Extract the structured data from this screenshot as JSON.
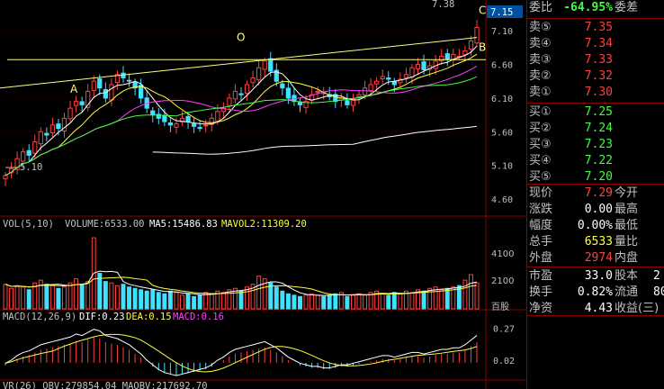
{
  "indicators": {
    "vol_text": "VOL(5,10)",
    "volume_text": "VOLUME:6533.00",
    "ma5_text": "MA5:15486.83",
    "mavol2_text": "MAVOL2:11309.20",
    "macd_params": "MACD(12,26,9)",
    "dif_text": "DIF:0.23",
    "dea_text": "DEA:0.15",
    "macd_text": "MACD:0.16",
    "bottom_text": "VR(26) OBV:279854.04 MAOBV:217692.70"
  },
  "chart_data": {
    "type": "candlestick",
    "title": "",
    "xlabel": "",
    "ylabel": "",
    "price_ylim": [
      4.4,
      7.45
    ],
    "price_ticks": [
      "7.10",
      "6.60",
      "6.10",
      "5.60",
      "5.10",
      "4.60"
    ],
    "volume_ticks": [
      "4100",
      "2100",
      "百股"
    ],
    "macd_ticks": [
      "0.27",
      "0.02"
    ],
    "last_price_label": "7.15",
    "high_label": "7.38",
    "low_label": "5.10",
    "annotations": [
      "A",
      "O",
      "B",
      "C"
    ],
    "colors": {
      "up": "#ff4040",
      "down": "#40e0ff",
      "ma5": "#ffffff",
      "ma10": "#ffff40",
      "ma20": "#ff40ff",
      "ma30": "#40ff40",
      "ma60": "#ffffff",
      "trendline": "#ffff80",
      "axis": "#8b0000"
    },
    "series_ohlc_note": "daily candles",
    "closes": [
      4.95,
      5.05,
      5.2,
      5.3,
      5.25,
      5.45,
      5.6,
      5.55,
      5.7,
      5.65,
      5.8,
      5.95,
      6.05,
      6.0,
      6.2,
      6.35,
      6.25,
      6.1,
      6.3,
      6.45,
      6.4,
      6.35,
      6.25,
      6.1,
      5.95,
      5.85,
      5.8,
      5.75,
      5.7,
      5.72,
      5.8,
      5.75,
      5.68,
      5.65,
      5.7,
      5.8,
      5.9,
      5.95,
      6.1,
      6.2,
      6.15,
      6.3,
      6.4,
      6.55,
      6.65,
      6.5,
      6.35,
      6.25,
      6.1,
      6.05,
      6.0,
      6.05,
      6.15,
      6.2,
      6.18,
      6.12,
      6.05,
      6.1,
      6.0,
      6.08,
      6.15,
      6.25,
      6.3,
      6.35,
      6.42,
      6.38,
      6.3,
      6.38,
      6.45,
      6.55,
      6.6,
      6.52,
      6.58,
      6.65,
      6.72,
      6.68,
      6.75,
      6.72,
      6.8,
      6.95,
      7.15
    ],
    "volume": [
      1800,
      1500,
      1700,
      1600,
      1400,
      1900,
      2100,
      1800,
      1700,
      1500,
      1600,
      1900,
      2200,
      1800,
      2000,
      5200,
      2600,
      2000,
      1900,
      1700,
      1800,
      1600,
      1500,
      1400,
      1300,
      1400,
      1200,
      1100,
      1300,
      1200,
      1000,
      1100,
      900,
      1000,
      1200,
      1100,
      1300,
      1200,
      1400,
      1500,
      1300,
      1600,
      1800,
      2400,
      2200,
      1900,
      1600,
      1300,
      1100,
      1000,
      900,
      1000,
      1100,
      1000,
      900,
      1000,
      1100,
      1200,
      900,
      1000,
      1100,
      1000,
      1200,
      1300,
      1100,
      1000,
      1200,
      1100,
      1300,
      1200,
      1400,
      1300,
      1500,
      1600,
      1400,
      1500,
      1600,
      1700,
      2100,
      2500,
      1900
    ],
    "macd": [
      -0.02,
      0.0,
      0.03,
      0.05,
      0.06,
      0.08,
      0.1,
      0.11,
      0.12,
      0.13,
      0.14,
      0.15,
      0.17,
      0.16,
      0.18,
      0.2,
      0.19,
      0.16,
      0.15,
      0.14,
      0.12,
      0.1,
      0.07,
      0.04,
      0.0,
      -0.03,
      -0.06,
      -0.08,
      -0.09,
      -0.1,
      -0.09,
      -0.08,
      -0.07,
      -0.06,
      -0.05,
      -0.03,
      0.0,
      0.02,
      0.05,
      0.07,
      0.08,
      0.09,
      0.1,
      0.11,
      0.12,
      0.1,
      0.08,
      0.05,
      0.02,
      0.0,
      -0.02,
      -0.03,
      -0.04,
      -0.04,
      -0.05,
      -0.05,
      -0.04,
      -0.03,
      -0.03,
      -0.02,
      -0.01,
      0.0,
      0.01,
      0.02,
      0.03,
      0.03,
      0.02,
      0.03,
      0.04,
      0.05,
      0.05,
      0.04,
      0.05,
      0.06,
      0.07,
      0.07,
      0.08,
      0.08,
      0.1,
      0.13,
      0.16
    ]
  },
  "quote": {
    "weibi_label": "委比",
    "weibi_value": "-64.95%",
    "weicha_label": "委差",
    "sell": [
      {
        "label": "卖⑤",
        "price": "7.35"
      },
      {
        "label": "卖④",
        "price": "7.34"
      },
      {
        "label": "卖③",
        "price": "7.33"
      },
      {
        "label": "卖②",
        "price": "7.32"
      },
      {
        "label": "卖①",
        "price": "7.30"
      }
    ],
    "buy": [
      {
        "label": "买①",
        "price": "7.25"
      },
      {
        "label": "买②",
        "price": "7.24"
      },
      {
        "label": "买③",
        "price": "7.23"
      },
      {
        "label": "买④",
        "price": "7.22"
      },
      {
        "label": "买⑤",
        "price": "7.20"
      }
    ],
    "stats": [
      {
        "label": "现价",
        "value": "7.29",
        "label2": "今开",
        "color": "#ff4040"
      },
      {
        "label": "涨跌",
        "value": "0.00",
        "label2": "最高",
        "color": "#ffffff"
      },
      {
        "label": "幅度",
        "value": "0.00%",
        "label2": "最低",
        "color": "#ffffff"
      },
      {
        "label": "总手",
        "value": "6533",
        "label2": "量比",
        "color": "#ffff40"
      },
      {
        "label": "外盘",
        "value": "2974",
        "label2": "内盘",
        "color": "#ff4040"
      }
    ],
    "stats2": [
      {
        "label": "市盈",
        "value": "33.0",
        "label2": "股本",
        "value2": "2"
      },
      {
        "label": "换手",
        "value": "0.82%",
        "label2": "流通",
        "value2": "80"
      },
      {
        "label": "净资",
        "value": "4.43",
        "label2": "收益(三)",
        "value2": ""
      }
    ]
  }
}
